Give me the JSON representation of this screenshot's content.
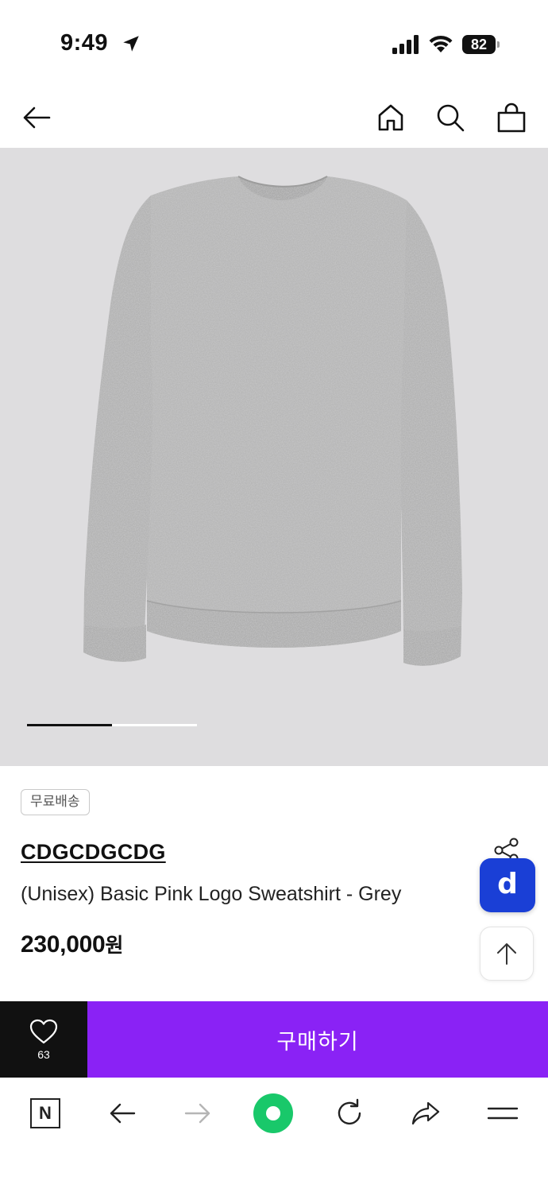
{
  "status_bar": {
    "time": "9:49",
    "battery": "82"
  },
  "header": {
    "back_icon": "arrow-left-icon",
    "home_icon": "home-icon",
    "search_icon": "search-icon",
    "bag_icon": "shopping-bag-icon"
  },
  "gallery": {
    "progress": 0.5
  },
  "product": {
    "badge": "무료배송",
    "brand": "CDGCDGCDG",
    "name": "(Unisex) Basic Pink Logo Sweatshirt - Grey",
    "price": "230,000",
    "price_unit": "원"
  },
  "floating": {
    "d_label": "d"
  },
  "purchase_bar": {
    "wish_count": "63",
    "buy_label": "구매하기"
  },
  "browser_bar": {
    "n_label": "N"
  },
  "colors": {
    "accent": "#8a22f5",
    "d_blue": "#1a3fd6",
    "green": "#19c86a",
    "image_bg": "#dedddf"
  }
}
